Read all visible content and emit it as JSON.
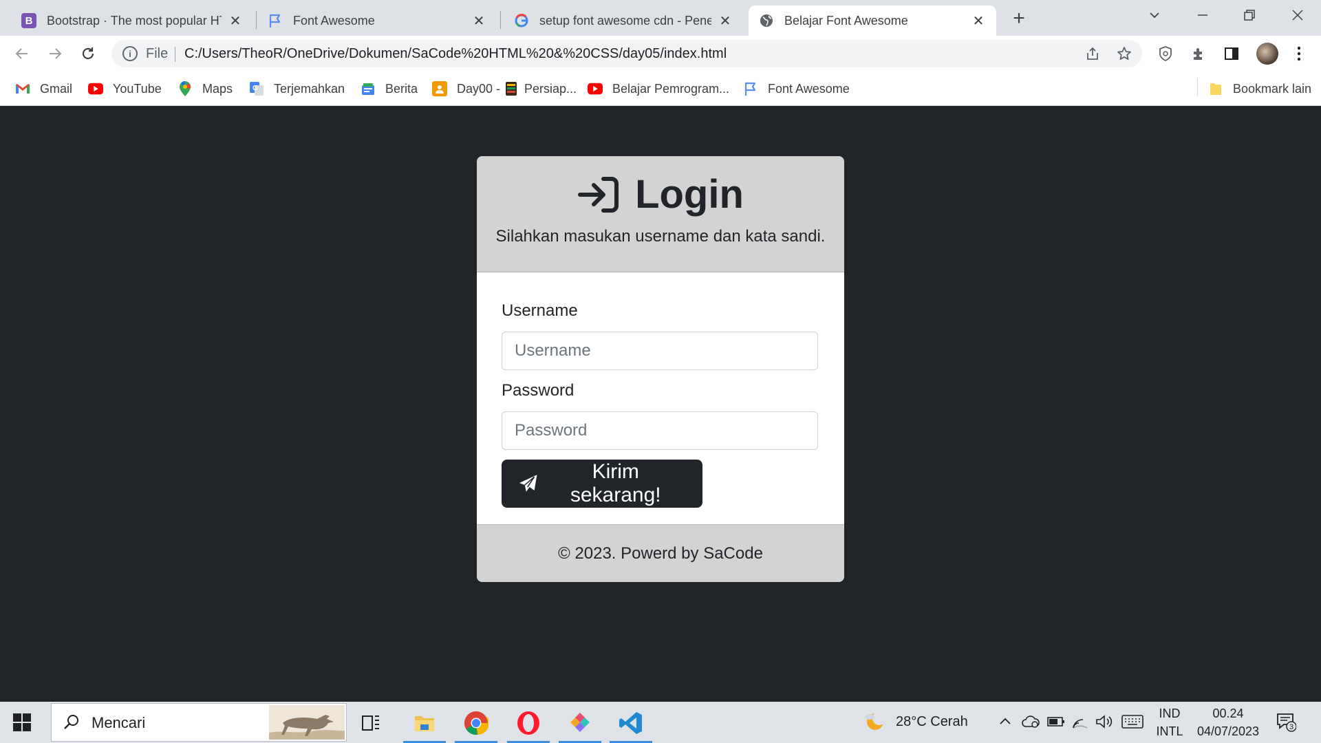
{
  "browser": {
    "tabs": [
      {
        "title": "Bootstrap · The most popular HTML, CSS, and JS library",
        "favicon": "bootstrap-icon",
        "active": false
      },
      {
        "title": "Font Awesome",
        "favicon": "flag-icon",
        "active": false
      },
      {
        "title": "setup font awesome cdn - Penelusuran Google",
        "favicon": "google-icon",
        "active": false
      },
      {
        "title": "Belajar Font Awesome",
        "favicon": "globe-icon",
        "active": true
      }
    ],
    "address": {
      "scheme": "File",
      "url": "C:/Users/TheoR/OneDrive/Dokumen/SaCode%20HTML%20&%20CSS/day05/index.html"
    },
    "bookmarks": [
      {
        "label": "Gmail",
        "icon": "gmail-icon"
      },
      {
        "label": "YouTube",
        "icon": "youtube-icon"
      },
      {
        "label": "Maps",
        "icon": "maps-icon"
      },
      {
        "label": "Terjemahkan",
        "icon": "translate-icon"
      },
      {
        "label": "Berita",
        "icon": "news-icon"
      },
      {
        "label": "Day00 - ",
        "icon": "classroom-icon"
      },
      {
        "label": "Persiap...",
        "icon": "notebook-icon"
      },
      {
        "label": "Belajar Pemrogram...",
        "icon": "youtube-icon"
      },
      {
        "label": "Font Awesome",
        "icon": "flag-icon"
      }
    ],
    "other_bookmarks": "Bookmark lain"
  },
  "login": {
    "title": "Login",
    "subtitle": "Silahkan masukan username dan kata sandi.",
    "username_label": "Username",
    "username_placeholder": "Username",
    "password_label": "Password",
    "password_placeholder": "Password",
    "submit_label": "Kirim sekarang!",
    "footer": "© 2023. Powerd by SaCode"
  },
  "taskbar": {
    "search_placeholder": "Mencari",
    "weather": "28°C  Cerah",
    "lang_top": "IND",
    "lang_bottom": "INTL",
    "time": "00.24",
    "date": "04/07/2023",
    "notification_count": "3"
  },
  "colors": {
    "page_bg": "#212529",
    "card_header_bg": "#d3d3d3",
    "button_bg": "#212529"
  }
}
